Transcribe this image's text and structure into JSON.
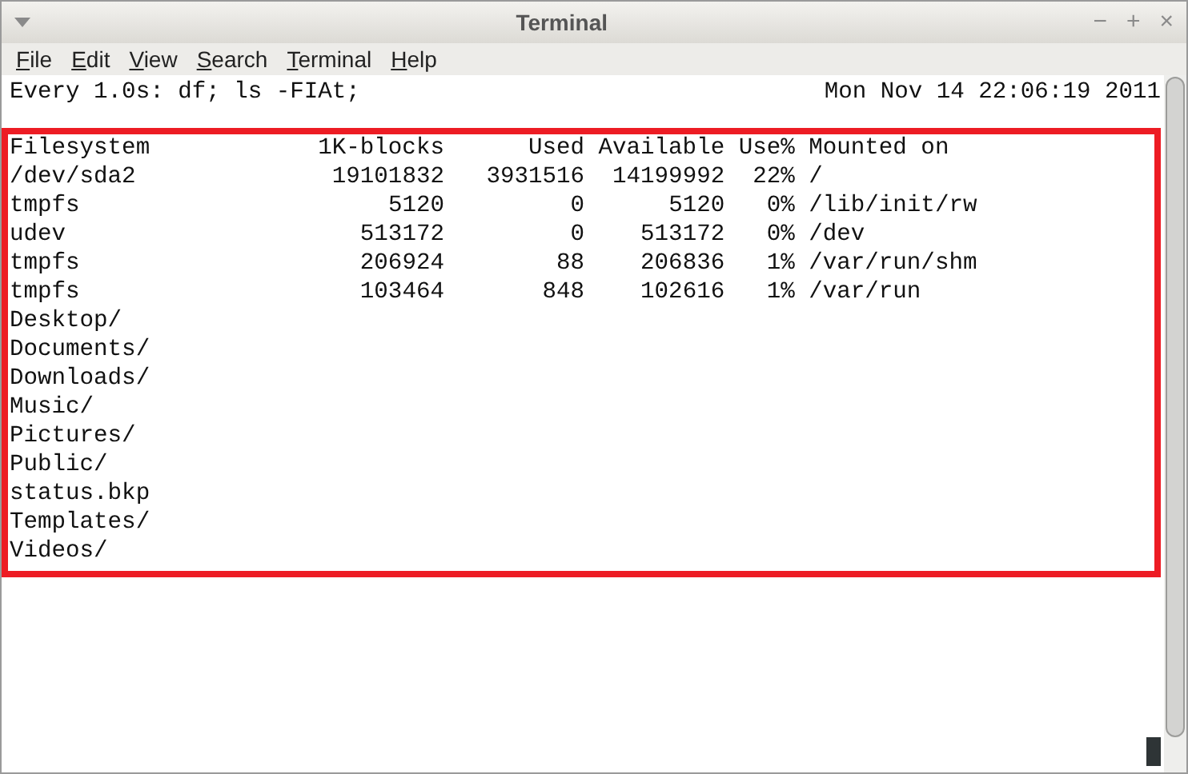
{
  "window": {
    "title": "Terminal",
    "controls": [
      "−",
      "+",
      "×"
    ]
  },
  "menu": [
    "File",
    "Edit",
    "View",
    "Search",
    "Terminal",
    "Help"
  ],
  "header": {
    "command": "Every 1.0s: df; ls -FIAt;",
    "time": "Mon Nov 14 22:06:19 2011"
  },
  "df": {
    "columns": [
      "Filesystem",
      "1K-blocks",
      "Used",
      "Available",
      "Use%",
      "Mounted on"
    ],
    "rows": [
      [
        "/dev/sda2",
        "19101832",
        "3931516",
        "14199992",
        "22%",
        "/"
      ],
      [
        "tmpfs",
        "5120",
        "0",
        "5120",
        "0%",
        "/lib/init/rw"
      ],
      [
        "udev",
        "513172",
        "0",
        "513172",
        "0%",
        "/dev"
      ],
      [
        "tmpfs",
        "206924",
        "88",
        "206836",
        "1%",
        "/var/run/shm"
      ],
      [
        "tmpfs",
        "103464",
        "848",
        "102616",
        "1%",
        "/var/run"
      ]
    ]
  },
  "listing": [
    "Desktop/",
    "Documents/",
    "Downloads/",
    "Music/",
    "Pictures/",
    "Public/",
    "status.bkp",
    "Templates/",
    "Videos/"
  ]
}
